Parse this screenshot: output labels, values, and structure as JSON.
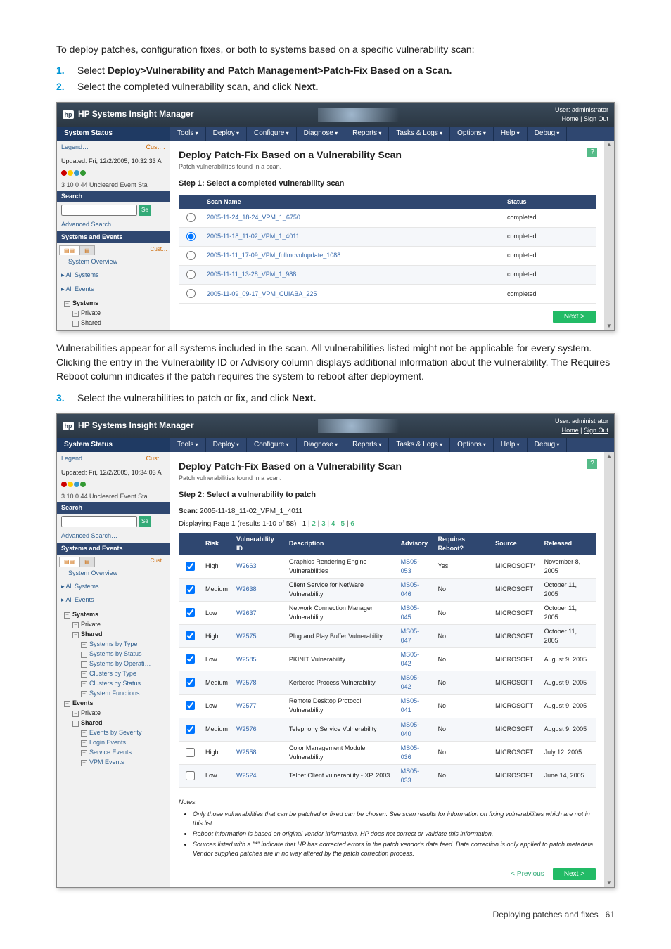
{
  "intro": "To deploy patches, configuration fixes, or both to systems based on a specific vulnerability scan:",
  "step1": {
    "num": "1.",
    "prefix": "Select ",
    "bold": "Deploy>Vulnerability and Patch Management>Patch-Fix Based on a Scan."
  },
  "step2": {
    "num": "2.",
    "prefix": "Select the completed vulnerability scan, and click ",
    "bold": "Next."
  },
  "paragraph2": "Vulnerabilities appear for all systems included in the scan. All vulnerabilities listed might not be applicable for every system. Clicking the entry in the Vulnerability ID or Advisory column displays additional information about the vulnerability. The Requires Reboot column indicates if the patch requires the system to reboot after deployment.",
  "step3": {
    "num": "3.",
    "prefix": "Select the vulnerabilities to patch or fix, and click ",
    "bold": "Next."
  },
  "app_title": "HP Systems Insight Manager",
  "user_label": "User: administrator",
  "home_link": "Home",
  "signout_link": "Sign Out",
  "status_header": "System Status",
  "menus": [
    "Tools",
    "Deploy",
    "Configure",
    "Diagnose",
    "Reports",
    "Tasks & Logs",
    "Options",
    "Help",
    "Debug"
  ],
  "left": {
    "legend": "Legend…",
    "customize": "Cust…",
    "updated1": "Updated: Fri, 12/2/2005, 10:32:33 A",
    "updated2": "Updated: Fri, 12/2/2005, 10:34:03 A",
    "counts": "3  10  0  44 Uncleared Event Sta",
    "search": "Search",
    "search_btn": "Se",
    "adv_search": "Advanced Search…",
    "sys_events": "Systems and Events",
    "customize2": "Cust…",
    "overview": "System Overview",
    "all_systems": "All Systems",
    "all_events": "All Events",
    "tree_systems": "Systems",
    "tree_private": "Private",
    "tree_shared": "Shared",
    "sys_by_type": "Systems by Type",
    "sys_by_status": "Systems by Status",
    "sys_by_os": "Systems by Operati…",
    "clusters_by_type": "Clusters by Type",
    "clusters_by_status": "Clusters by Status",
    "sys_functions": "System Functions",
    "events": "Events",
    "ev_by_sev": "Events by Severity",
    "login_events": "Login Events",
    "service_events": "Service Events",
    "vpm_events": "VPM Events"
  },
  "main1": {
    "title": "Deploy Patch-Fix Based on a Vulnerability Scan",
    "subtitle": "Patch vulnerabilities found in a scan.",
    "step": "Step 1: Select a completed vulnerability scan",
    "cols": {
      "name": "Scan Name",
      "status": "Status"
    },
    "rows": [
      {
        "name": "2005-11-24_18-24_VPM_1_6750",
        "status": "completed"
      },
      {
        "name": "2005-11-18_11-02_VPM_1_4011",
        "status": "completed"
      },
      {
        "name": "2005-11-11_17-09_VPM_fullmovulupdate_1088",
        "status": "completed"
      },
      {
        "name": "2005-11-11_13-28_VPM_1_988",
        "status": "completed"
      },
      {
        "name": "2005-11-09_09-17_VPM_CUIABA_225",
        "status": "completed"
      }
    ],
    "next": "Next >"
  },
  "main2": {
    "title": "Deploy Patch-Fix Based on a Vulnerability Scan",
    "subtitle": "Patch vulnerabilities found in a scan.",
    "step": "Step 2: Select a vulnerability to patch",
    "scan_label": "Scan:",
    "scan_name": "2005-11-18_11-02_VPM_1_4011",
    "paging_label": "Displaying Page 1 (results 1-10 of 58)",
    "pages": [
      "1",
      "2",
      "3",
      "4",
      "5",
      "6"
    ],
    "cols": {
      "risk": "Risk",
      "vid": "Vulnerability ID",
      "desc": "Description",
      "advisory": "Advisory",
      "reboot": "Requires Reboot?",
      "source": "Source",
      "released": "Released"
    },
    "rows": [
      {
        "chk": true,
        "risk": "High",
        "vid": "W2663",
        "desc": "Graphics Rendering Engine Vulnerabilities",
        "adv": "MS05-053",
        "reboot": "Yes",
        "src": "MICROSOFT*",
        "rel": "November 8, 2005"
      },
      {
        "chk": true,
        "risk": "Medium",
        "vid": "W2638",
        "desc": "Client Service for NetWare Vulnerability",
        "adv": "MS05-046",
        "reboot": "No",
        "src": "MICROSOFT",
        "rel": "October 11, 2005"
      },
      {
        "chk": true,
        "risk": "Low",
        "vid": "W2637",
        "desc": "Network Connection Manager Vulnerability",
        "adv": "MS05-045",
        "reboot": "No",
        "src": "MICROSOFT",
        "rel": "October 11, 2005"
      },
      {
        "chk": true,
        "risk": "High",
        "vid": "W2575",
        "desc": "Plug and Play Buffer Vulnerability",
        "adv": "MS05-047",
        "reboot": "No",
        "src": "MICROSOFT",
        "rel": "October 11, 2005"
      },
      {
        "chk": true,
        "risk": "Low",
        "vid": "W2585",
        "desc": "PKINIT Vulnerability",
        "adv": "MS05-042",
        "reboot": "No",
        "src": "MICROSOFT",
        "rel": "August 9, 2005"
      },
      {
        "chk": true,
        "risk": "Medium",
        "vid": "W2578",
        "desc": "Kerberos Process Vulnerability",
        "adv": "MS05-042",
        "reboot": "No",
        "src": "MICROSOFT",
        "rel": "August 9, 2005"
      },
      {
        "chk": true,
        "risk": "Low",
        "vid": "W2577",
        "desc": "Remote Desktop Protocol Vulnerability",
        "adv": "MS05-041",
        "reboot": "No",
        "src": "MICROSOFT",
        "rel": "August 9, 2005"
      },
      {
        "chk": true,
        "risk": "Medium",
        "vid": "W2576",
        "desc": "Telephony Service Vulnerability",
        "adv": "MS05-040",
        "reboot": "No",
        "src": "MICROSOFT",
        "rel": "August 9, 2005"
      },
      {
        "chk": false,
        "risk": "High",
        "vid": "W2558",
        "desc": "Color Management Module Vulnerability",
        "adv": "MS05-036",
        "reboot": "No",
        "src": "MICROSOFT",
        "rel": "July 12, 2005"
      },
      {
        "chk": false,
        "risk": "Low",
        "vid": "W2524",
        "desc": "Telnet Client vulnerability - XP, 2003",
        "adv": "MS05-033",
        "reboot": "No",
        "src": "MICROSOFT",
        "rel": "June 14, 2005"
      }
    ],
    "notes_hdr": "Notes:",
    "note1": "Only those vulnerabilities that can be patched or fixed can be chosen. See scan results for information on fixing vulnerabilities which are not in this list.",
    "note2": "Reboot information is based on original vendor information. HP does not correct or validate this information.",
    "note3": "Sources listed with a \"*\" indicate that HP has corrected errors in the patch vendor's data feed. Data correction is only applied to patch metadata. Vendor supplied patches are in no way altered by the patch correction process.",
    "prev": "< Previous",
    "next": "Next >"
  },
  "footer_text": "Deploying patches and fixes",
  "footer_page": "61"
}
